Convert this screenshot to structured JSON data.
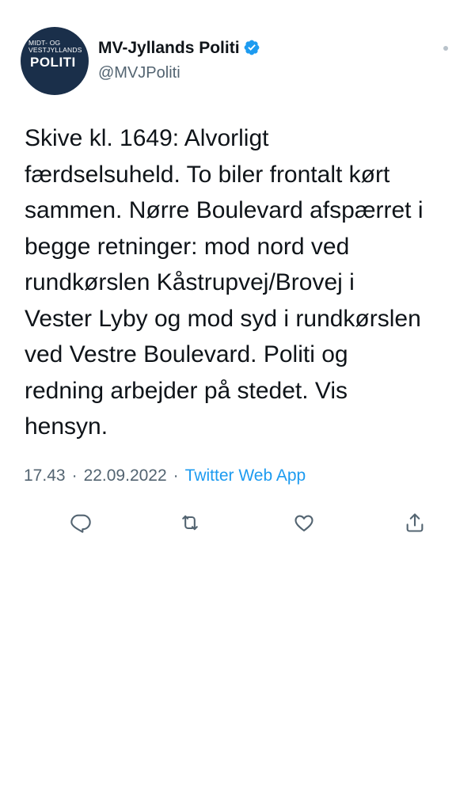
{
  "tweet": {
    "avatar": {
      "small_text": "MIDT- OG\nVESTJYLLANDS",
      "big_text": "POLITI"
    },
    "display_name": "MV-Jyllands Politi",
    "handle": "@MVJPoliti",
    "verified": true,
    "text": "Skive kl. 1649: Alvorligt\nfærdselsuheld. To biler frontalt kørt\nsammen. Nørre Boulevard afspærret i\nbegge retninger: mod nord ved\nrundkørslen Kåstrupvej/Brovej i\nVester Lyby og mod syd i rundkørslen\nved Vestre Boulevard. Politi og\nredning arbejder på stedet. Vis\nhensyn.",
    "time": "17.43",
    "separator": "·",
    "date": "22.09.2022",
    "source": "Twitter Web App"
  },
  "actions": [
    {
      "icon": "reply-icon"
    },
    {
      "icon": "retweet-icon"
    },
    {
      "icon": "like-icon"
    },
    {
      "icon": "share-icon"
    }
  ],
  "colors": {
    "text": "#0f1419",
    "secondary": "#536471",
    "accent": "#1d9bf0",
    "avatar_bg": "#1a2f4a"
  }
}
